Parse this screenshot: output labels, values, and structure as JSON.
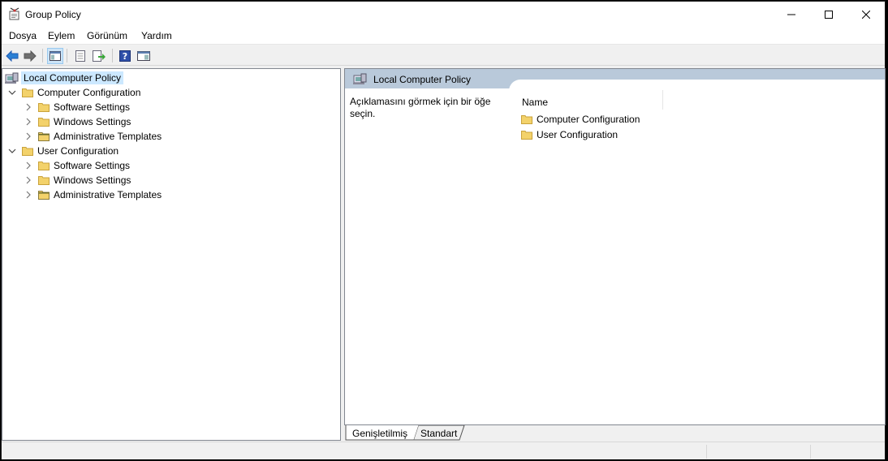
{
  "window": {
    "title": "Group Policy",
    "app_icon": "group-policy-icon"
  },
  "caption_buttons": {
    "minimize": "minimize-icon",
    "maximize": "maximize-icon",
    "close": "close-icon"
  },
  "menu": {
    "items": [
      "Dosya",
      "Eylem",
      "Görünüm",
      "Yardım"
    ]
  },
  "toolbar": {
    "buttons": [
      "back-arrow-icon",
      "forward-arrow-icon",
      "show-hide-console-tree-icon",
      "properties-icon",
      "export-list-icon",
      "help-icon",
      "show-hide-action-pane-icon"
    ]
  },
  "tree": {
    "root": "Local Computer Policy",
    "nodes": [
      {
        "label": "Computer Configuration",
        "expanded": true,
        "children": [
          "Software Settings",
          "Windows Settings",
          "Administrative Templates"
        ]
      },
      {
        "label": "User Configuration",
        "expanded": true,
        "children": [
          "Software Settings",
          "Windows Settings",
          "Administrative Templates"
        ]
      }
    ]
  },
  "result": {
    "header_title": "Local Computer Policy",
    "description": "Açıklamasını görmek için bir öğe seçin.",
    "column_name": "Name",
    "items": [
      "Computer Configuration",
      "User Configuration"
    ]
  },
  "tabs": {
    "extended": "Genişletilmiş",
    "standard": "Standart",
    "active": "Genişletilmiş"
  },
  "colors": {
    "selection": "#cce8ff",
    "header_band": "#b9c9da",
    "folder": "#f3d26b",
    "accent_blue": "#1e5bb5"
  }
}
